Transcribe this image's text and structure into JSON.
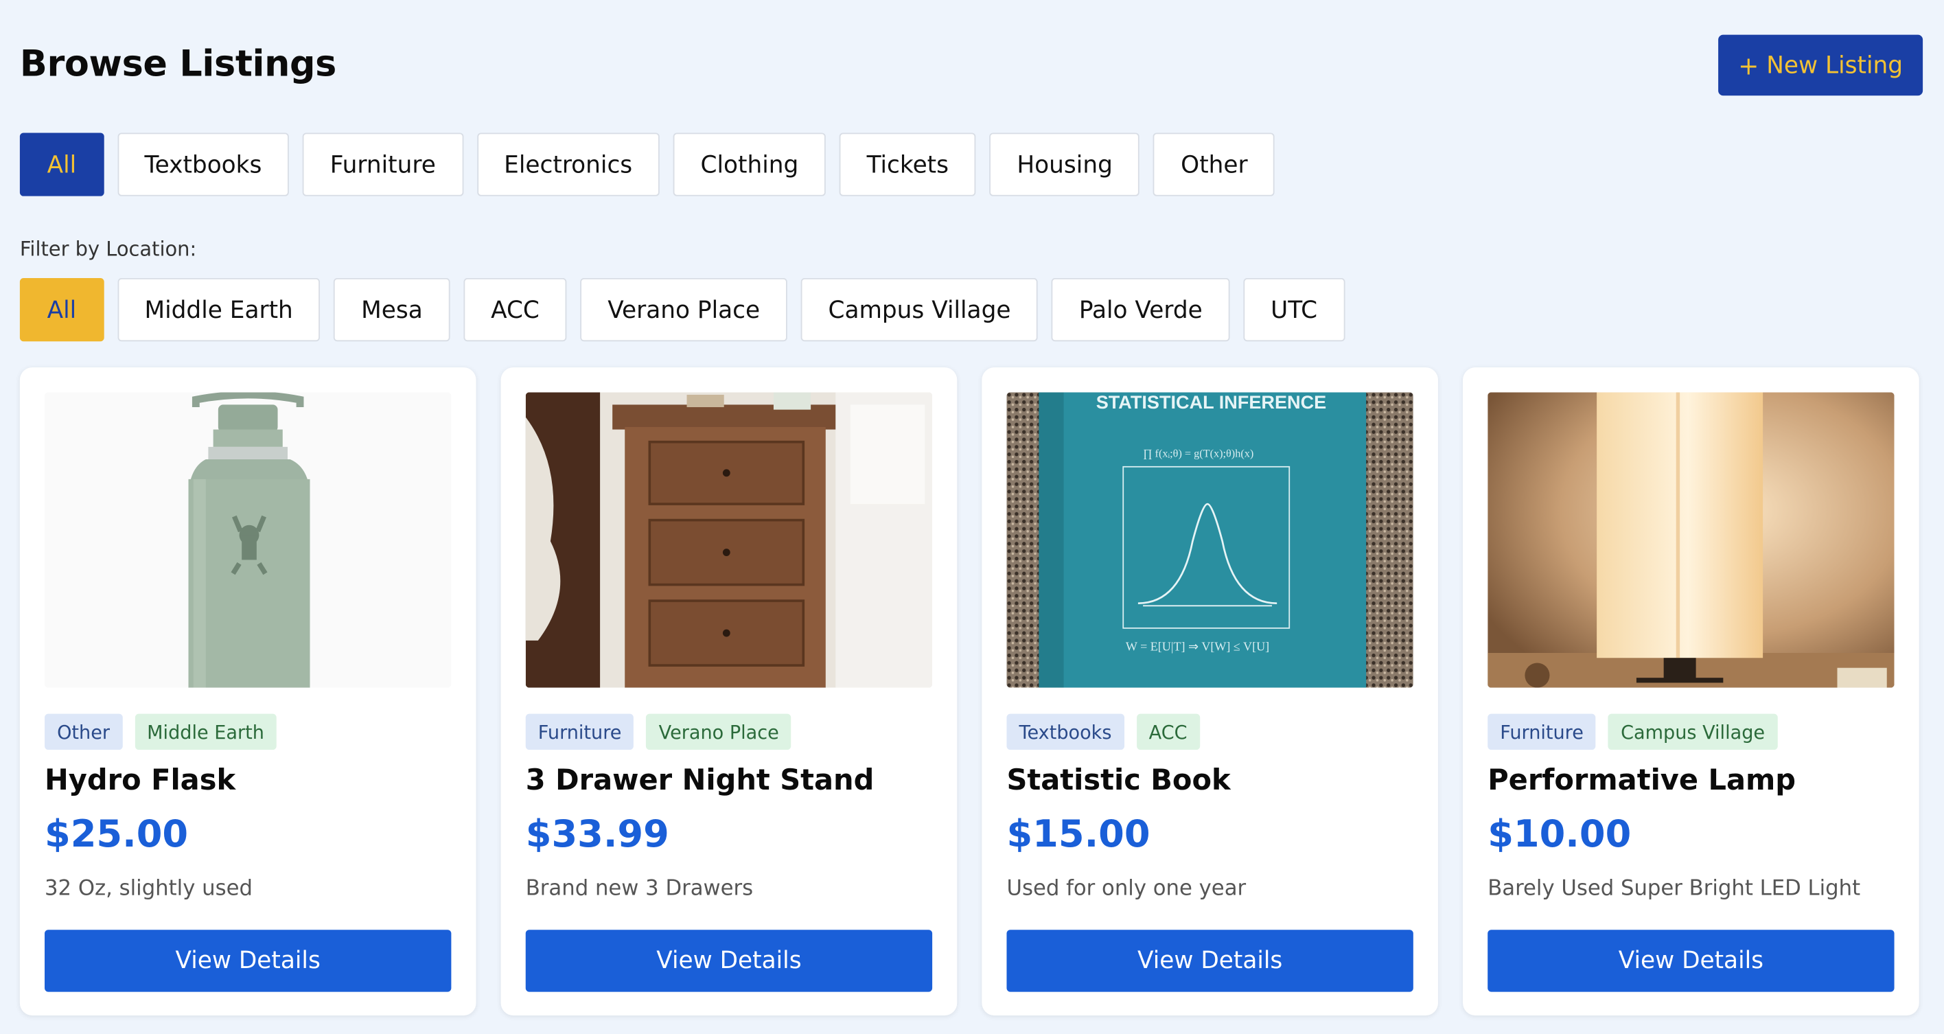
{
  "page": {
    "title": "Browse Listings",
    "new_listing_label": "New Listing",
    "new_listing_icon": "+"
  },
  "categories": [
    {
      "label": "All",
      "active": true
    },
    {
      "label": "Textbooks"
    },
    {
      "label": "Furniture"
    },
    {
      "label": "Electronics"
    },
    {
      "label": "Clothing"
    },
    {
      "label": "Tickets"
    },
    {
      "label": "Housing"
    },
    {
      "label": "Other"
    }
  ],
  "location_filter": {
    "label": "Filter by Location:",
    "options": [
      {
        "label": "All",
        "active": true
      },
      {
        "label": "Middle Earth"
      },
      {
        "label": "Mesa"
      },
      {
        "label": "ACC"
      },
      {
        "label": "Verano Place"
      },
      {
        "label": "Campus Village"
      },
      {
        "label": "Palo Verde"
      },
      {
        "label": "UTC"
      }
    ]
  },
  "listings": [
    {
      "category": "Other",
      "location": "Middle Earth",
      "title": "Hydro Flask",
      "price": "$25.00",
      "description": "32 Oz, slightly used",
      "button": "View Details",
      "image": "water-bottle"
    },
    {
      "category": "Furniture",
      "location": "Verano Place",
      "title": "3 Drawer Night Stand",
      "price": "$33.99",
      "description": "Brand new 3 Drawers",
      "button": "View Details",
      "image": "nightstand"
    },
    {
      "category": "Textbooks",
      "location": "ACC",
      "title": "Statistic Book",
      "price": "$15.00",
      "description": "Used for only one year",
      "button": "View Details",
      "image": "textbook",
      "image_text": "STATISTICAL INFERENCE"
    },
    {
      "category": "Furniture",
      "location": "Campus Village",
      "title": "Performative Lamp",
      "price": "$10.00",
      "description": "Barely Used Super Bright LED Light",
      "button": "View Details",
      "image": "lamp"
    }
  ],
  "colors": {
    "primary_blue": "#1a3fa5",
    "accent_gold": "#f0b72f",
    "price_blue": "#1a5fd8",
    "page_bg": "#eef4fc"
  }
}
